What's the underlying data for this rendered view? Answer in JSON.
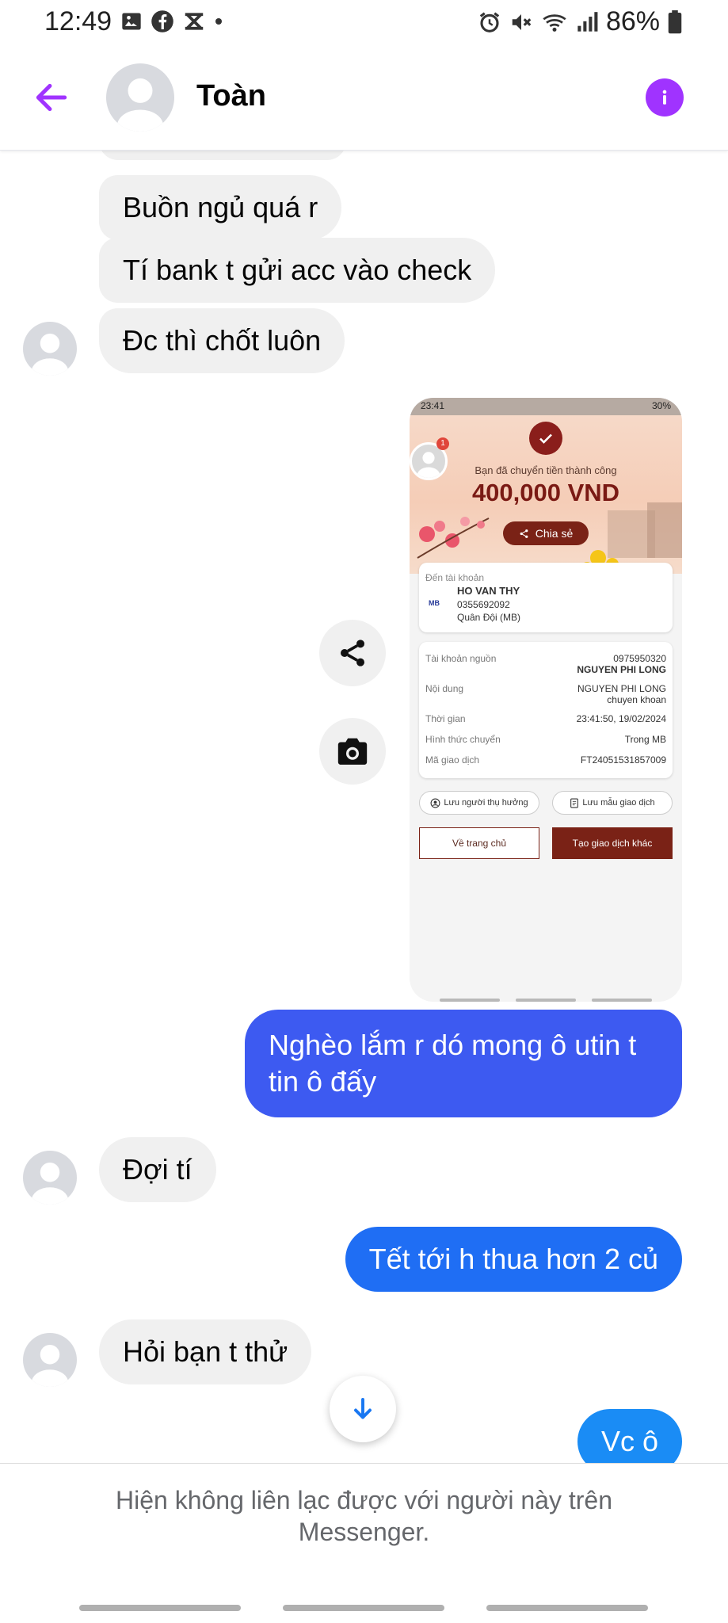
{
  "status_bar": {
    "time": "12:49",
    "battery": "86%"
  },
  "header": {
    "contact_name": "Toàn",
    "accent_color": "#a033ff"
  },
  "messages": [
    {
      "side": "in",
      "text": "Buồn ngủ quá r"
    },
    {
      "side": "in",
      "text": "Tí bank t gửi acc vào check"
    },
    {
      "side": "in",
      "text": "Đc thì chốt luôn"
    },
    {
      "side": "out",
      "text_line1": "Nghèo lắm r dó mong ô utin t",
      "text_line2": "tin ô đấy",
      "color": "#3d5af1"
    },
    {
      "side": "in",
      "text": "Đợi tí"
    },
    {
      "side": "out",
      "text": "Tết tới h thua hơn 2 củ",
      "color": "#1f6ef4"
    },
    {
      "side": "in",
      "text": "Hỏi bạn t thử"
    },
    {
      "side": "out",
      "text": "Vc ô",
      "color": "#1a8cf5"
    }
  ],
  "attachment": {
    "status_time": "23:41",
    "status_battery": "30%",
    "badge_count": "1",
    "subtitle": "Bạn đã chuyển tiền thành công",
    "amount": "400,000 VND",
    "share_label": "Chia sẻ",
    "to_label": "Đến tài khoản",
    "bank_code": "MB",
    "recipient_name": "HO VAN THY",
    "recipient_account": "0355692092",
    "recipient_bank": "Quân Đội (MB)",
    "details": [
      {
        "key": "Tài khoản nguồn",
        "value": "0975950320",
        "value2": "NGUYEN PHI LONG"
      },
      {
        "key": "Nội dung",
        "value": "NGUYEN PHI LONG",
        "value2": "chuyen khoan"
      },
      {
        "key": "Thời gian",
        "value": "23:41:50, 19/02/2024"
      },
      {
        "key": "Hình thức chuyển",
        "value": "Trong MB"
      },
      {
        "key": "Mã giao dịch",
        "value": "FT24051531857009"
      }
    ],
    "save_beneficiary": "Lưu người thụ hưởng",
    "save_template": "Lưu mẫu giao dịch",
    "home_button": "Về trang chủ",
    "new_transaction_button": "Tạo giao dịch khác"
  },
  "footer": {
    "notice": "Hiện không liên lạc được với người này trên Messenger."
  }
}
